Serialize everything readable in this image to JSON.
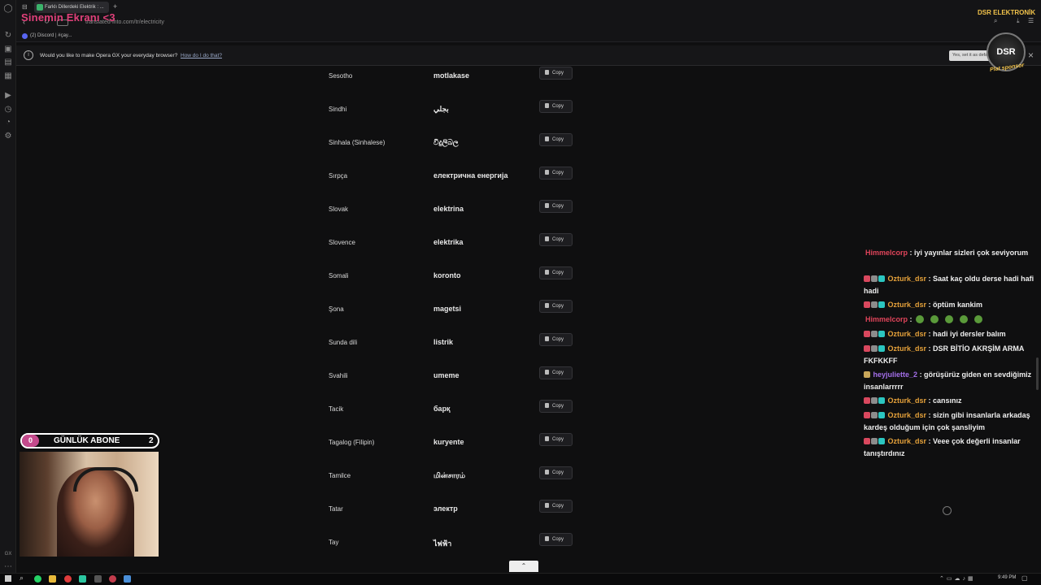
{
  "overlay_title": "Sinemin Ekranı <3",
  "browser": {
    "tab_title": "Farklı Dillerdeki Elektrik : ...",
    "url": "translated-into.com/tr/electricity",
    "bookmark": "(2) Discord | #çay...",
    "infobar_text": "Would you like to make Opera GX your everyday browser?",
    "infobar_link": "How do I do that?",
    "infobar_button": "Yes, set it as default browser"
  },
  "copy_label": "Copy",
  "translations": [
    {
      "lang": "Sesotho",
      "word": "motlakase"
    },
    {
      "lang": "Sindhi",
      "word": "بجلي"
    },
    {
      "lang": "Sinhala (Sinhalese)",
      "word": "විදුලිබල"
    },
    {
      "lang": "Sırpça",
      "word": "електрична енергија"
    },
    {
      "lang": "Slovak",
      "word": "elektrina"
    },
    {
      "lang": "Slovence",
      "word": "elektrika"
    },
    {
      "lang": "Somali",
      "word": "koronto"
    },
    {
      "lang": "Şona",
      "word": "magetsi"
    },
    {
      "lang": "Sunda dili",
      "word": "listrik"
    },
    {
      "lang": "Svahili",
      "word": "umeme"
    },
    {
      "lang": "Tacik",
      "word": "барқ"
    },
    {
      "lang": "Tagalog (Filipin)",
      "word": "kuryente"
    },
    {
      "lang": "Tamilce",
      "word": "மின்சாரம்"
    },
    {
      "lang": "Tatar",
      "word": "электр"
    },
    {
      "lang": "Tay",
      "word": "ไฟฟ้า"
    }
  ],
  "abone": {
    "left": "0",
    "title": "GÜNLÜK ABONE",
    "count": "2"
  },
  "logo": {
    "brand": "DSR ELEKTRONİK",
    "badge": "DSR",
    "sponsor": "Plat sponsor"
  },
  "chat": [
    {
      "user": "Himmelcorp",
      "text": ": iyi yayınlar sizleri çok seviyorum"
    },
    {
      "user": "Ozturk_dsr",
      "text": ": Saat kaç oldu derse hadi hafi hadi"
    },
    {
      "user": "Ozturk_dsr",
      "text": ": öptüm kankim"
    },
    {
      "user": "Himmelcorp",
      "text": ":"
    },
    {
      "user": "Ozturk_dsr",
      "text": ": hadi iyi dersler balım"
    },
    {
      "user": "Ozturk_dsr",
      "text": ": DSR BİTİO AKRŞİM ARMA FKFKKFF"
    },
    {
      "user": "heyjuliette_2",
      "text": ": görüşürüz giden en sevdiğimiz insanlarrrrr"
    },
    {
      "user": "Ozturk_dsr",
      "text": ": cansınız"
    },
    {
      "user": "Ozturk_dsr",
      "text": ": sizin gibi insanlarla arkadaş kardeş olduğum için çok şansliyim"
    },
    {
      "user": "Ozturk_dsr",
      "text": ": Veee çok değerli insanlar tanıştırdınız"
    }
  ],
  "clock": "9:49 PM"
}
